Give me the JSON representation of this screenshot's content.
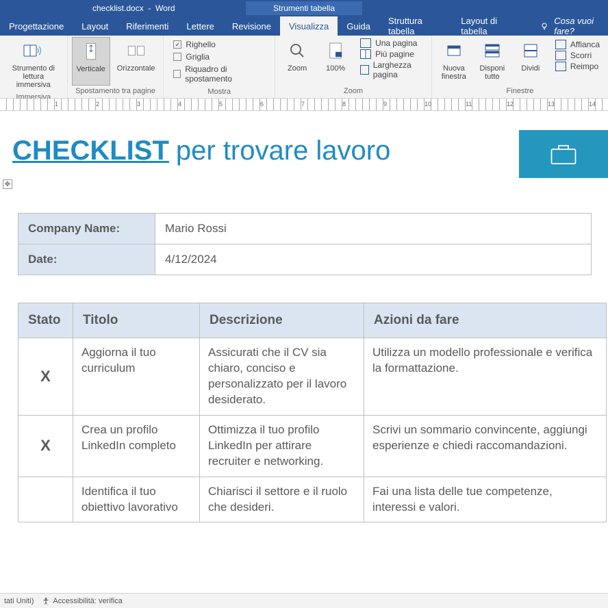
{
  "titlebar": {
    "filename": "checklist.docx",
    "app": "Word",
    "context": "Strumenti tabella"
  },
  "tabs": [
    "Progettazione",
    "Layout",
    "Riferimenti",
    "Lettere",
    "Revisione",
    "Visualizza",
    "Guida",
    "Struttura tabella",
    "Layout di tabella"
  ],
  "active_tab": "Visualizza",
  "tell_me": "Cosa vuoi fare?",
  "ribbon": {
    "immersiva": {
      "btn": "Strumento di\nlettura immersiva",
      "label": "Immersiva"
    },
    "spostamento": {
      "verticale": "Verticale",
      "orizzontale": "Orizzontale",
      "label": "Spostamento tra pagine"
    },
    "mostra": {
      "righello": "Righello",
      "griglia": "Griglia",
      "riquadro": "Riquadro di spostamento",
      "label": "Mostra"
    },
    "zoom": {
      "zoom": "Zoom",
      "p100": "100%",
      "una": "Una pagina",
      "piu": "Più pagine",
      "larghezza": "Larghezza pagina",
      "label": "Zoom"
    },
    "finestra": {
      "nuova": "Nuova\nfinestra",
      "disponi": "Disponi\ntutto",
      "dividi": "Dividi",
      "affianca": "Affianca",
      "scorri": "Scorri",
      "reimp": "Reimpo",
      "label": "Finestre"
    }
  },
  "document": {
    "title_bold": "CHECKLIST",
    "title_rest": "per trovare lavoro",
    "info": {
      "company_label": "Company Name:",
      "company_value": "Mario Rossi",
      "date_label": "Date:",
      "date_value": "4/12/2024"
    },
    "headers": {
      "stato": "Stato",
      "titolo": "Titolo",
      "descrizione": "Descrizione",
      "azioni": "Azioni da fare"
    },
    "rows": [
      {
        "stato": "X",
        "titolo": "Aggiorna il tuo curriculum",
        "desc": "Assicurati che il CV sia chiaro, conciso e personalizzato per il lavoro desiderato.",
        "azioni": "Utilizza un modello professionale e verifica la formattazione."
      },
      {
        "stato": "X",
        "titolo": "Crea un profilo LinkedIn completo",
        "desc": "Ottimizza il tuo profilo LinkedIn per attirare recruiter e networking.",
        "azioni": "Scrivi un sommario convincente, aggiungi esperienze e chiedi raccomandazioni."
      },
      {
        "stato": "",
        "titolo": "Identifica il tuo obiettivo lavorativo",
        "desc": "Chiarisci il settore e il ruolo che desideri.",
        "azioni": "Fai una lista delle tue competenze, interessi e valori."
      }
    ]
  },
  "statusbar": {
    "lang": "tati Uniti)",
    "accessibility": "Accessibilità: verifica"
  }
}
